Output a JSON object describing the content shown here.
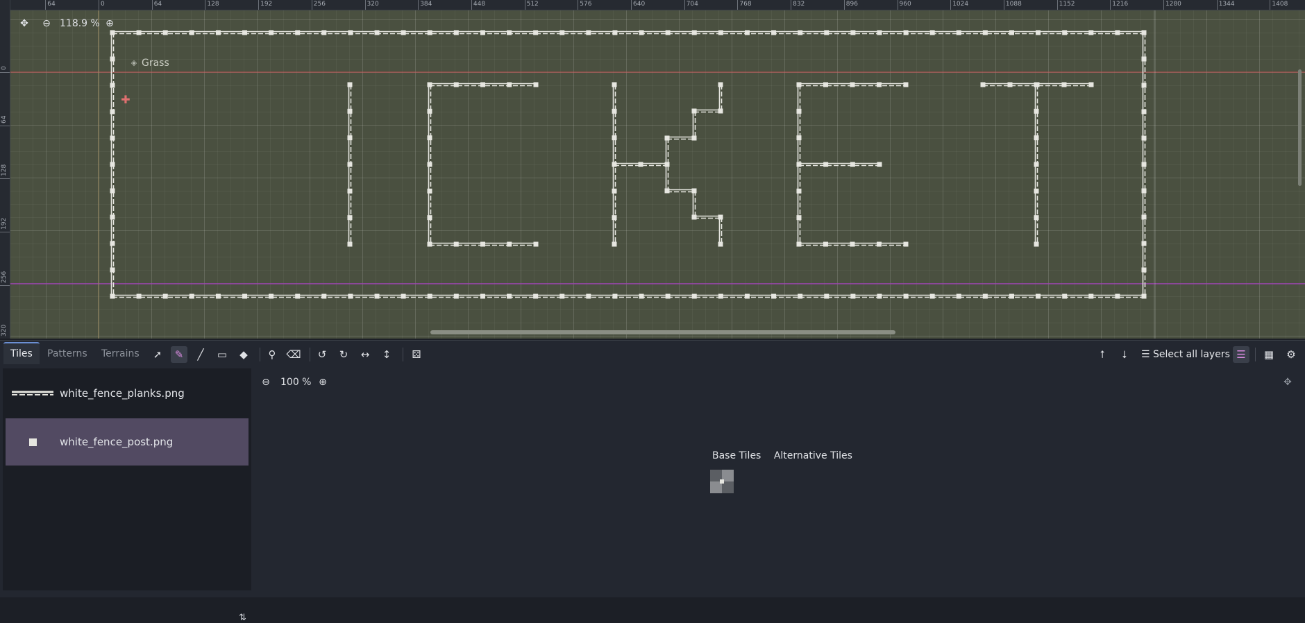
{
  "viewport": {
    "zoom_label": "118.9 %",
    "layer_label": "Grass",
    "ruler_top": [
      "64",
      "0",
      "64",
      "128",
      "192",
      "256",
      "320",
      "384",
      "448",
      "512",
      "576",
      "640",
      "704",
      "768",
      "832",
      "896",
      "960",
      "1024",
      "1088",
      "1152",
      "1216",
      "1280",
      "1344",
      "1408"
    ],
    "ruler_left": [
      "0",
      "64",
      "128",
      "192",
      "256",
      "320"
    ],
    "icons": {
      "center": "center-view-icon",
      "zoom_out": "zoom-out-icon",
      "zoom_in": "zoom-in-icon",
      "layer": "layer-diamond-icon",
      "cursor": "paint-cursor-icon"
    }
  },
  "toolbar": {
    "tabs": [
      "Tiles",
      "Patterns",
      "Terrains"
    ],
    "active_tab": "Tiles",
    "tools": [
      "select-icon",
      "paint-icon",
      "line-icon",
      "rect-icon",
      "bucket-icon",
      "picker-icon",
      "eraser-icon",
      "rotate-left-icon",
      "rotate-right-icon",
      "flip-h-icon",
      "flip-v-icon",
      "random-icon"
    ],
    "select_all_label": "Select all layers",
    "right_icons": [
      "move-up-icon",
      "move-down-icon",
      "layers-list-icon",
      "highlight-layer-icon",
      "grid-icon",
      "settings-icon"
    ]
  },
  "sources": {
    "items": [
      {
        "label": "white_fence_planks.png",
        "thumb": "planks"
      },
      {
        "label": "white_fence_post.png",
        "thumb": "post"
      }
    ],
    "selected_index": 1,
    "sort_icon": "sort-icon"
  },
  "atlas": {
    "zoom_label": "100 %",
    "tabs": [
      "Base Tiles",
      "Alternative Tiles"
    ]
  },
  "colors": {
    "grass_bg": "#4a5040",
    "fence": "#e6e6e0",
    "selected_source": "#524a62",
    "red_line": "#c05050",
    "purple_line": "#9a3fb0"
  }
}
